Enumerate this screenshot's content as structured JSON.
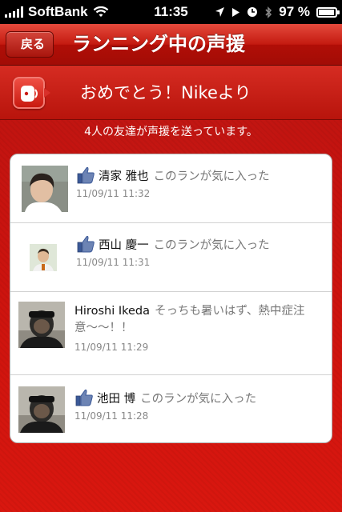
{
  "status_bar": {
    "carrier": "SoftBank",
    "time": "11:35",
    "battery": "97 %",
    "battery_level": 0.97
  },
  "nav": {
    "back_label": "戻る",
    "title": "ランニング中の声援"
  },
  "cheer": {
    "title": "おめでとう！Nikeより"
  },
  "friends_count_text": "4人の友達が声援を送っています。",
  "items": [
    {
      "name": "清家 雅也",
      "message": "このランが気に入った",
      "timestamp": "11/09/11  11:32"
    },
    {
      "name": "西山 慶一",
      "message": "このランが気に入った",
      "timestamp": "11/09/11  11:31"
    },
    {
      "name": "Hiroshi Ikeda",
      "message": "そっちも暑いはず、熱中症注意〜〜！！",
      "timestamp": "11/09/11  11:29"
    },
    {
      "name": "池田 博",
      "message": "このランが気に入った",
      "timestamp": "11/09/11  11:28"
    }
  ],
  "colors": {
    "accent_red": "#c8120e",
    "like_blue": "#3b5998"
  },
  "icons": [
    "wifi-icon",
    "location-arrow-icon",
    "play-icon",
    "alarm-icon",
    "bluetooth-icon",
    "battery-icon",
    "cheer-speaker-icon",
    "like-thumb-icon",
    "avatar"
  ]
}
